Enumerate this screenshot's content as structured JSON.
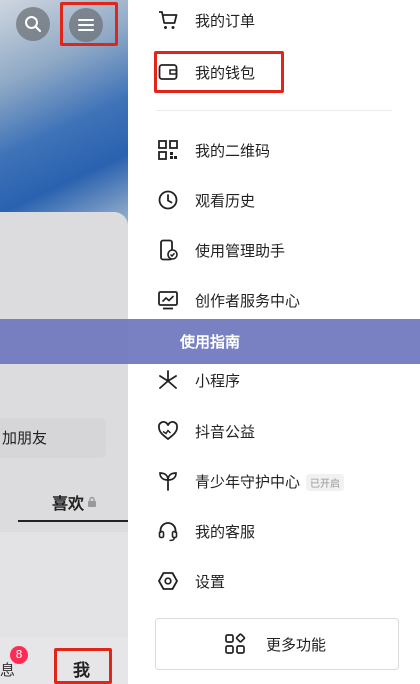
{
  "left": {
    "add_friend": "加朋友",
    "likes_tab": "喜欢",
    "message_partial": "息",
    "message_badge": "8",
    "me_tab": "我"
  },
  "menu": {
    "items": [
      {
        "label": "我的订单",
        "icon": "cart-icon"
      },
      {
        "label": "我的钱包",
        "icon": "wallet-icon"
      },
      {
        "label": "我的二维码",
        "icon": "qrcode-icon"
      },
      {
        "label": "观看历史",
        "icon": "clock-icon"
      },
      {
        "label": "使用管理助手",
        "icon": "phone-check-icon"
      },
      {
        "label": "创作者服务中心",
        "icon": "chart-monitor-icon"
      },
      {
        "label": "小程序",
        "icon": "mini-program-icon"
      },
      {
        "label": "抖音公益",
        "icon": "charity-heart-icon"
      },
      {
        "label": "青少年守护中心",
        "icon": "sprout-icon",
        "tag": "已开启"
      },
      {
        "label": "我的客服",
        "icon": "headset-icon"
      },
      {
        "label": "设置",
        "icon": "settings-hex-icon"
      }
    ],
    "more_button": "更多功能"
  },
  "banner": {
    "text": "使用指南"
  },
  "colors": {
    "highlight_red": "#e0251b",
    "banner": "#6e76be",
    "badge": "#fe2c55"
  }
}
